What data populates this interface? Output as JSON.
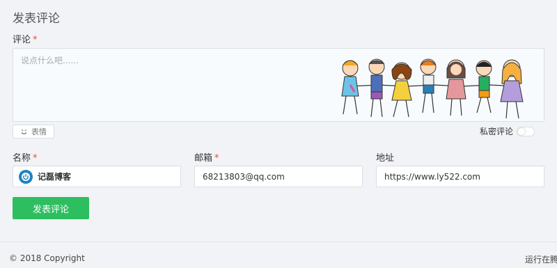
{
  "section": {
    "title": "发表评论"
  },
  "comment": {
    "label": "评论",
    "required_mark": "*",
    "placeholder": "说点什么吧......",
    "emoji_button": "表情",
    "private_label": "私密评论",
    "private_enabled": false
  },
  "fields": {
    "name": {
      "label": "名称",
      "required_mark": "*",
      "value": "记磊博客"
    },
    "email": {
      "label": "邮箱",
      "required_mark": "*",
      "value": "68213803@qq.com"
    },
    "url": {
      "label": "地址",
      "value": "https://www.ly522.com"
    }
  },
  "submit": {
    "label": "发表评论"
  },
  "footer": {
    "copyright": "© 2018 Copyright",
    "running": "运行在腾"
  },
  "colors": {
    "accent": "#2dbe60",
    "required": "#e54d42",
    "avatar": "#1e82c4"
  }
}
